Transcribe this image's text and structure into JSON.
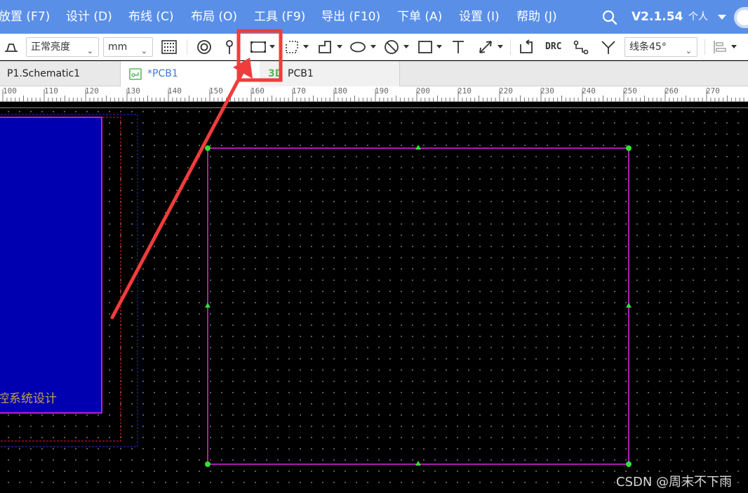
{
  "menubar": {
    "items": [
      {
        "label": "放置 (F7)"
      },
      {
        "label": "设计 (D)"
      },
      {
        "label": "布线 (C)"
      },
      {
        "label": "布局 (O)"
      },
      {
        "label": "工具 (F9)"
      },
      {
        "label": "导出 (F10)"
      },
      {
        "label": "下单 (A)"
      },
      {
        "label": "设置 (I)"
      },
      {
        "label": "帮助 (J)"
      }
    ],
    "version": "V2.1.54",
    "user_label": "个人"
  },
  "toolbar": {
    "brightness": "正常亮度",
    "unit": "mm",
    "drc_label": "DRC",
    "route_angle": "线条45°"
  },
  "tabs": [
    {
      "label": "P1.Schematic1"
    },
    {
      "label": "*PCB1"
    },
    {
      "label": "PCB1",
      "badge": "3D"
    }
  ],
  "ruler": {
    "labels": [
      "100",
      "110",
      "120",
      "130",
      "140",
      "150",
      "160",
      "170",
      "180",
      "190",
      "200",
      "210",
      "220",
      "230",
      "240",
      "250",
      "260",
      "270"
    ]
  },
  "canvas": {
    "board_text": "控系统设计"
  },
  "colors": {
    "menubar_bg": "#5a8fe8",
    "annotation": "#f03c3c",
    "board_outline": "#c020c0",
    "handle": "#33e033",
    "board_fill": "#0000b0"
  },
  "watermark": "CSDN @周末不下雨"
}
